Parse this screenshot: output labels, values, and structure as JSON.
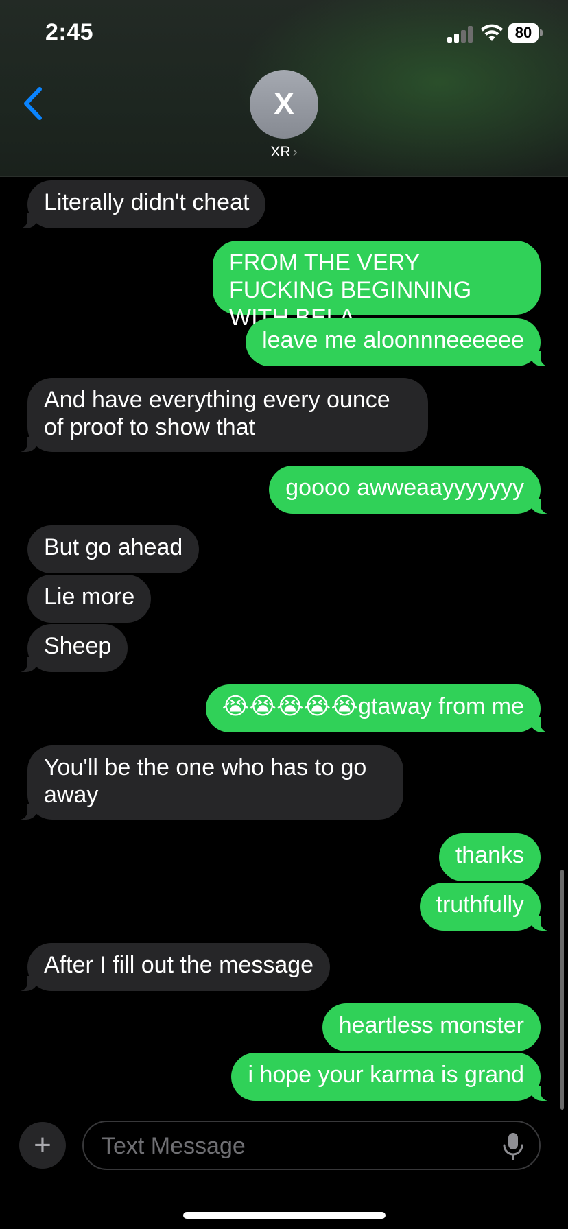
{
  "status_bar": {
    "time": "2:45",
    "battery": "80"
  },
  "header": {
    "avatar_initial": "X",
    "contact_name": "XR",
    "contact_chevron": "›"
  },
  "messages": [
    {
      "dir": "in",
      "text": "Literally didn't cheat"
    },
    {
      "dir": "out",
      "text": "FROM THE VERY FUCKING BEGINNING WITH BELA"
    },
    {
      "dir": "out",
      "text": "leave me aloonnneeeeee"
    },
    {
      "dir": "in",
      "text": "And have everything every ounce of proof to show that"
    },
    {
      "dir": "out",
      "text": "goooo awweaayyyyyyy"
    },
    {
      "dir": "in",
      "text": "But go ahead"
    },
    {
      "dir": "in",
      "text": "Lie more"
    },
    {
      "dir": "in",
      "text": "Sheep"
    },
    {
      "dir": "out",
      "text": "😭😭😭😭😭gtaway from me"
    },
    {
      "dir": "in",
      "text": "You'll be the one who has to go away"
    },
    {
      "dir": "out",
      "text": "thanks"
    },
    {
      "dir": "out",
      "text": "truthfully"
    },
    {
      "dir": "in",
      "text": "After I fill out the message"
    },
    {
      "dir": "out",
      "text": "heartless monster"
    },
    {
      "dir": "out",
      "text": "i hope your karma is grand"
    }
  ],
  "composer": {
    "plus_label": "+",
    "placeholder": "Text Message"
  },
  "colors": {
    "outgoing_bubble": "#30d158",
    "incoming_bubble": "#262628",
    "accent_blue": "#0a84ff"
  },
  "icons": {
    "back": "chevron-left-icon",
    "signal": "signal-icon",
    "wifi": "wifi-icon",
    "battery": "battery-icon",
    "plus": "plus-icon",
    "mic": "microphone-icon"
  }
}
